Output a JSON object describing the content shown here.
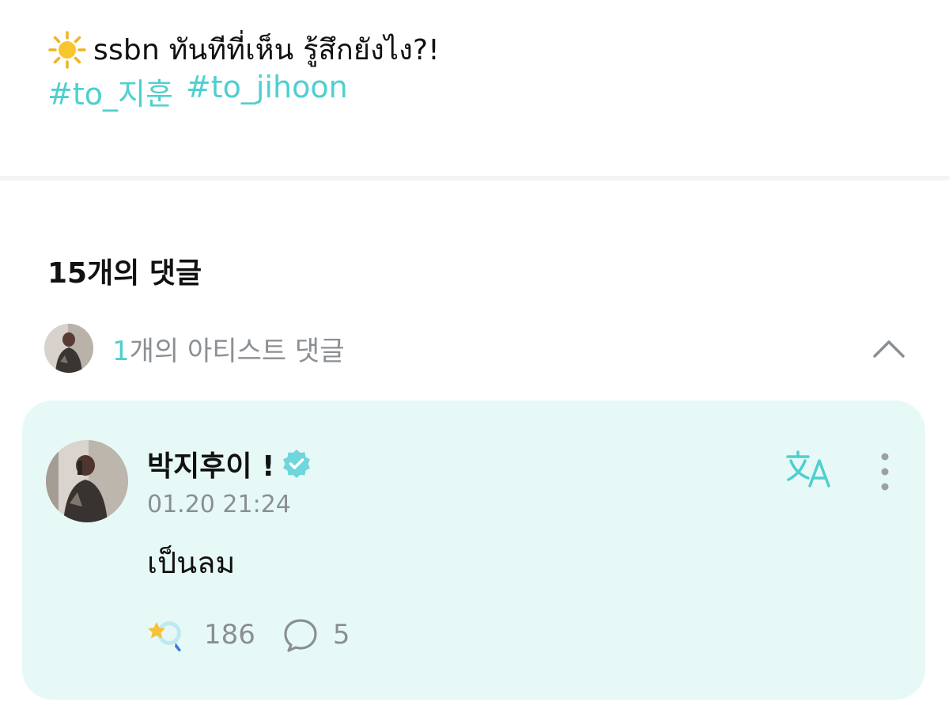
{
  "post": {
    "emoji_icon": "sun-icon",
    "text": "ssbn ทันทีที่เห็น รู้สึกยังไง?!",
    "hashtags": [
      "#to_지훈",
      "#to_jihoon"
    ]
  },
  "comments": {
    "count_title": "15개의 댓글",
    "artist": {
      "count": "1",
      "label": "개의 아티스트 댓글",
      "collapse_icon": "chevron-up-icon"
    },
    "items": [
      {
        "author": "박지후이 !",
        "verified_icon": "verified-badge-icon",
        "time": "01.20 21:24",
        "body": "เป็นลม",
        "like_count": "186",
        "reply_count": "5"
      }
    ]
  },
  "colors": {
    "accent": "#4fcfcf",
    "card_bg": "#e7f9f7",
    "muted_text": "#8a8f94"
  }
}
